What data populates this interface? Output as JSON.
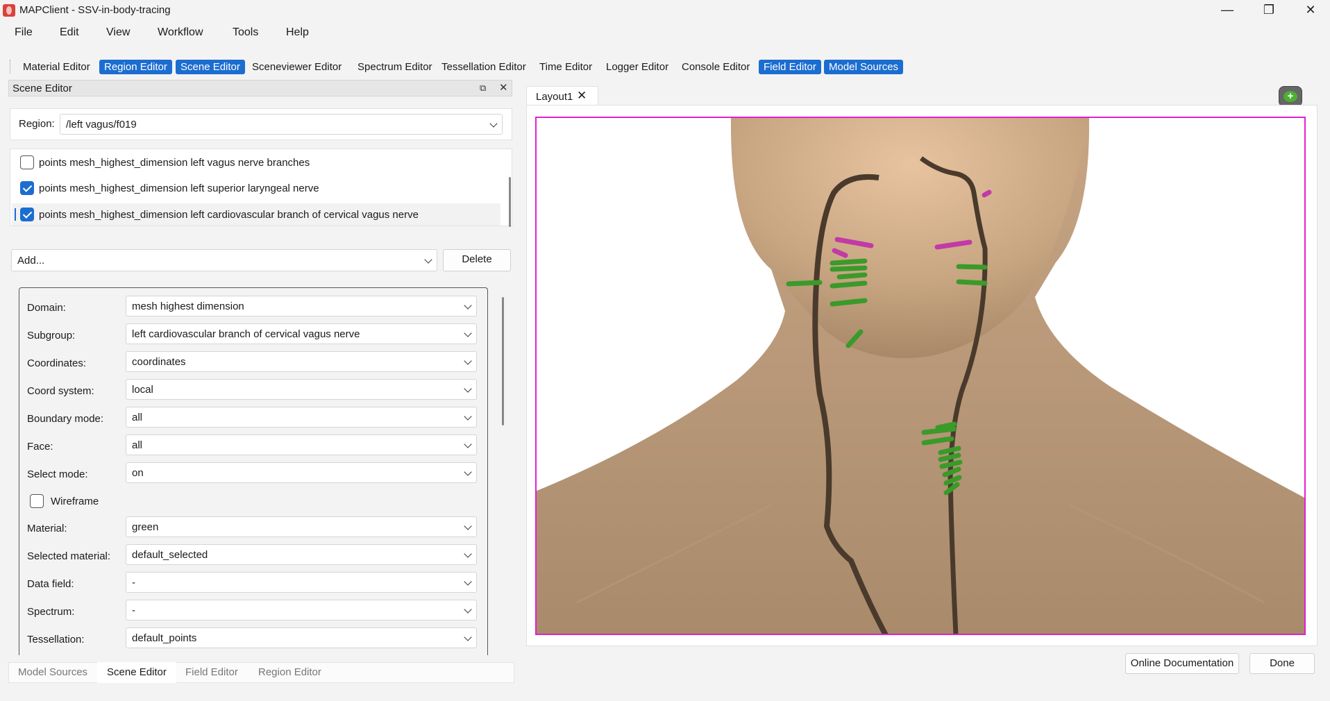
{
  "window": {
    "title": "MAPClient - SSV-in-body-tracing"
  },
  "menu": [
    "File",
    "Edit",
    "View",
    "Workflow",
    "Tools",
    "Help"
  ],
  "toolbar": [
    {
      "label": "Material Editor",
      "active": false
    },
    {
      "label": "Region Editor",
      "active": true
    },
    {
      "label": "Scene Editor",
      "active": true
    },
    {
      "label": "Sceneviewer Editor",
      "active": false
    },
    {
      "label": "Spectrum Editor",
      "active": false
    },
    {
      "label": "Tessellation Editor",
      "active": false
    },
    {
      "label": "Time Editor",
      "active": false
    },
    {
      "label": "Logger Editor",
      "active": false
    },
    {
      "label": "Console Editor",
      "active": false
    },
    {
      "label": "Field Editor",
      "active": true
    },
    {
      "label": "Model Sources",
      "active": true
    }
  ],
  "dock": {
    "title": "Scene Editor"
  },
  "region": {
    "label": "Region:",
    "value": "/left vagus/f019"
  },
  "graphics": [
    {
      "label": "points mesh_highest_dimension left vagus nerve branches",
      "checked": false
    },
    {
      "label": "points mesh_highest_dimension left superior laryngeal nerve",
      "checked": true
    },
    {
      "label": "points mesh_highest_dimension left cardiovascular branch of cervical vagus nerve",
      "checked": true
    }
  ],
  "add": {
    "value": "Add...",
    "delete_label": "Delete"
  },
  "props": {
    "domain": {
      "label": "Domain:",
      "value": "mesh highest dimension"
    },
    "subgroup": {
      "label": "Subgroup:",
      "value": "left cardiovascular branch of cervical vagus nerve"
    },
    "coordinates": {
      "label": "Coordinates:",
      "value": "coordinates"
    },
    "coord_system": {
      "label": "Coord system:",
      "value": "local"
    },
    "boundary": {
      "label": "Boundary mode:",
      "value": "all"
    },
    "face": {
      "label": "Face:",
      "value": "all"
    },
    "select_mode": {
      "label": "Select mode:",
      "value": "on"
    },
    "wireframe": {
      "label": "Wireframe",
      "checked": false
    },
    "material": {
      "label": "Material:",
      "value": "green"
    },
    "selected_material": {
      "label": "Selected material:",
      "value": "default_selected"
    },
    "data_field": {
      "label": "Data field:",
      "value": "-"
    },
    "spectrum": {
      "label": "Spectrum:",
      "value": "-"
    },
    "tessellation": {
      "label": "Tessellation:",
      "value": "default_points"
    }
  },
  "bottom_tabs": [
    "Model Sources",
    "Scene Editor",
    "Field Editor",
    "Region Editor"
  ],
  "layout_tab": "Layout1",
  "footer": {
    "docs": "Online Documentation",
    "done": "Done"
  },
  "colors": {
    "accent": "#1c6dd0",
    "viewport_border": "#e01fd0",
    "nerve": "#4a3a2c",
    "green_marker": "#3a9a2a",
    "magenta_marker": "#c23aa6"
  }
}
